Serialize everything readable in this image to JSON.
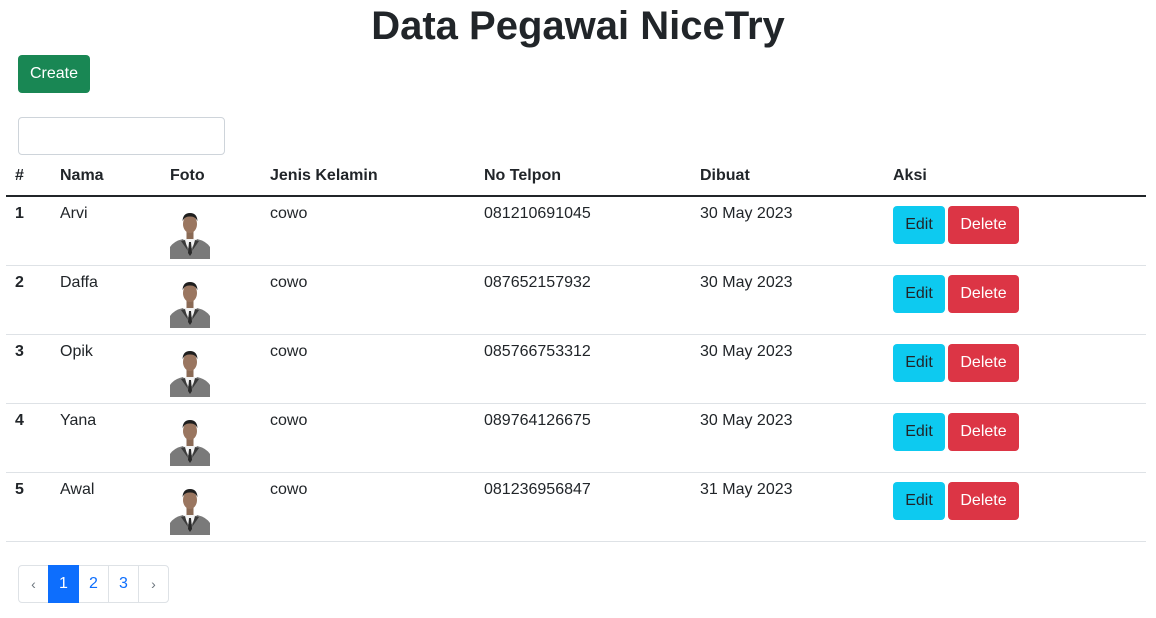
{
  "page": {
    "title": "Data Pegawai NiceTry"
  },
  "toolbar": {
    "create_label": "Create",
    "search_value": "",
    "search_placeholder": ""
  },
  "table": {
    "headers": [
      "#",
      "Nama",
      "Foto",
      "Jenis Kelamin",
      "No Telpon",
      "Dibuat",
      "Aksi"
    ],
    "rows": [
      {
        "no": "1",
        "nama": "Arvi",
        "jenis_kelamin": "cowo",
        "telpon": "081210691045",
        "dibuat": "30 May 2023",
        "edit": "Edit",
        "delete": "Delete"
      },
      {
        "no": "2",
        "nama": "Daffa",
        "jenis_kelamin": "cowo",
        "telpon": "087652157932",
        "dibuat": "30 May 2023",
        "edit": "Edit",
        "delete": "Delete"
      },
      {
        "no": "3",
        "nama": "Opik",
        "jenis_kelamin": "cowo",
        "telpon": "085766753312",
        "dibuat": "30 May 2023",
        "edit": "Edit",
        "delete": "Delete"
      },
      {
        "no": "4",
        "nama": "Yana",
        "jenis_kelamin": "cowo",
        "telpon": "089764126675",
        "dibuat": "30 May 2023",
        "edit": "Edit",
        "delete": "Delete"
      },
      {
        "no": "5",
        "nama": "Awal",
        "jenis_kelamin": "cowo",
        "telpon": "081236956847",
        "dibuat": "31 May 2023",
        "edit": "Edit",
        "delete": "Delete"
      }
    ]
  },
  "pagination": {
    "prev": "‹",
    "next": "›",
    "pages": [
      "1",
      "2",
      "3"
    ],
    "active": "1"
  },
  "colors": {
    "create": "#198754",
    "edit": "#0dcaf0",
    "delete": "#dc3545",
    "page_active": "#0d6efd"
  },
  "icons": {
    "photo": "person-photo"
  }
}
